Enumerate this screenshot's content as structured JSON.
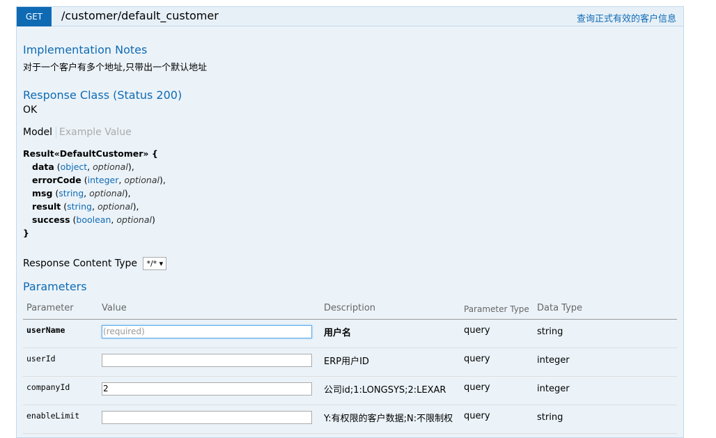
{
  "operation": {
    "method": "GET",
    "path": "/customer/default_customer",
    "summary": "查询正式有效的客户信息"
  },
  "implementation_notes": {
    "heading": "Implementation Notes",
    "text": "对于一个客户有多个地址,只带出一个默认地址"
  },
  "response_class": {
    "heading": "Response Class (Status 200)",
    "status_text": "OK",
    "tab_model": "Model",
    "tab_example": "Example Value",
    "model_title": "Result«DefaultCustomer» {",
    "model_close": "}",
    "fields": [
      {
        "name": "data",
        "type": "object",
        "optional": "optional"
      },
      {
        "name": "errorCode",
        "type": "integer",
        "optional": "optional"
      },
      {
        "name": "msg",
        "type": "string",
        "optional": "optional"
      },
      {
        "name": "result",
        "type": "string",
        "optional": "optional"
      },
      {
        "name": "success",
        "type": "boolean",
        "optional": "optional"
      }
    ]
  },
  "response_content_type": {
    "label": "Response Content Type",
    "selected": "*/*"
  },
  "parameters": {
    "heading": "Parameters",
    "columns": {
      "parameter": "Parameter",
      "value": "Value",
      "description": "Description",
      "param_type": "Parameter Type",
      "data_type": "Data Type"
    },
    "rows": [
      {
        "name": "userName",
        "value": "",
        "placeholder": "(required)",
        "description": "用户名",
        "param_type": "query",
        "data_type": "string"
      },
      {
        "name": "userId",
        "value": "",
        "placeholder": "",
        "description": "ERP用户ID",
        "param_type": "query",
        "data_type": "integer"
      },
      {
        "name": "companyId",
        "value": "2",
        "placeholder": "",
        "description": "公司id;1:LONGSYS;2:LEXAR",
        "param_type": "query",
        "data_type": "integer"
      },
      {
        "name": "enableLimit",
        "value": "",
        "placeholder": "",
        "description": "Y:有权限的客户数据;N:不限制权",
        "param_type": "query",
        "data_type": "string"
      }
    ]
  }
}
